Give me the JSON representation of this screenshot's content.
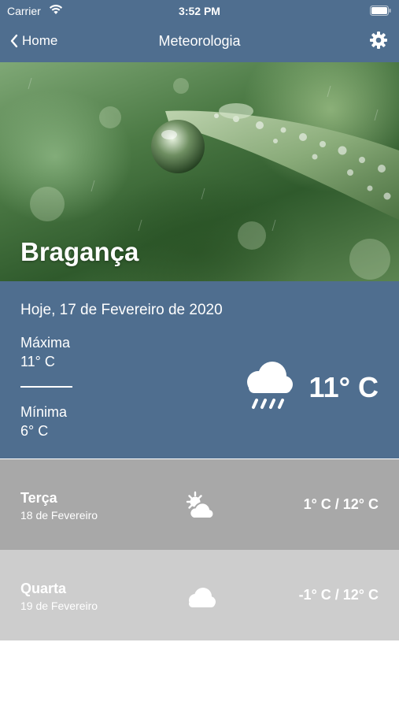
{
  "status_bar": {
    "carrier": "Carrier",
    "time": "3:52 PM",
    "wifi_icon": "wifi-icon",
    "battery_icon": "battery-icon"
  },
  "nav": {
    "back_label": "Home",
    "title": "Meteorologia",
    "settings_icon": "gear-icon"
  },
  "hero": {
    "city": "Bragança"
  },
  "today": {
    "date": "Hoje, 17 de Fevereiro de 2020",
    "max_label": "Máxima",
    "max_value": "11° C",
    "min_label": "Mínima",
    "min_value": "6° C",
    "current_temp": "11° C",
    "icon": "cloud-rain-icon"
  },
  "forecast": [
    {
      "day": "Terça",
      "date": "18 de Fevereiro",
      "range": "1° C / 12° C",
      "icon": "partly-sunny-icon"
    },
    {
      "day": "Quarta",
      "date": "19 de Fevereiro",
      "range": "-1° C / 12° C",
      "icon": "cloud-icon"
    }
  ],
  "colors": {
    "header_blue": "#4f6e8f",
    "row_gray_dark": "#a8a8a8",
    "row_gray_light": "#cdcdcd"
  }
}
